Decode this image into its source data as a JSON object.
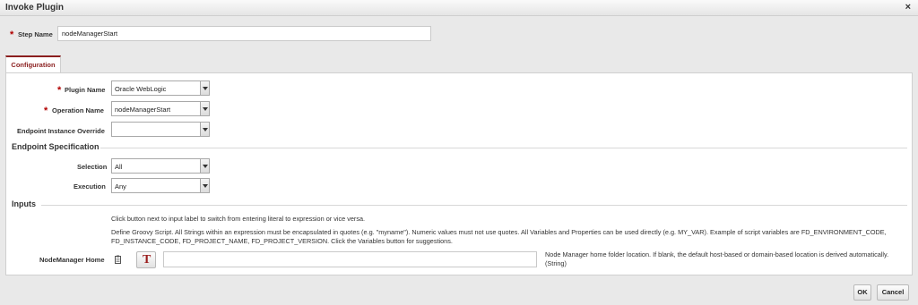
{
  "dialog": {
    "title": "Invoke Plugin",
    "close": "×"
  },
  "step": {
    "label": "Step Name",
    "value": "nodeManagerStart"
  },
  "tabs": [
    {
      "label": "Configuration",
      "active": true
    }
  ],
  "config": {
    "plugin_name": {
      "label": "Plugin Name",
      "value": "Oracle WebLogic",
      "required": true
    },
    "operation_name": {
      "label": "Operation Name",
      "value": "nodeManagerStart",
      "required": true
    },
    "endpoint_override": {
      "label": "Endpoint Instance Override",
      "value": ""
    }
  },
  "endpoint_spec": {
    "heading": "Endpoint Specification",
    "selection": {
      "label": "Selection",
      "value": "All"
    },
    "execution": {
      "label": "Execution",
      "value": "Any"
    }
  },
  "inputs": {
    "heading": "Inputs",
    "hint1": "Click button next to input label to switch from entering literal to expression or vice versa.",
    "hint2": "Define Groovy Script. All Strings within an expression must be encapsulated in quotes (e.g. \"myname\"). Numeric values must not use quotes. All Variables and Properties can be used directly (e.g. MY_VAR). Example of script variables are FD_ENVIRONMENT_CODE, FD_INSTANCE_CODE, FD_PROJECT_NAME, FD_PROJECT_VERSION. Click the Variables button for suggestions.",
    "nodemanager_home": {
      "label": "NodeManager Home",
      "value": "",
      "toggle_glyph": "T",
      "help": "Node Manager home folder location. If blank, the default host-based or domain-based location is derived automatically. (String)"
    }
  },
  "footer": {
    "ok": "OK",
    "cancel": "Cancel"
  },
  "colors": {
    "accent": "#8b1f1f",
    "required": "#b10000",
    "toggle": "#9a1c1c"
  }
}
